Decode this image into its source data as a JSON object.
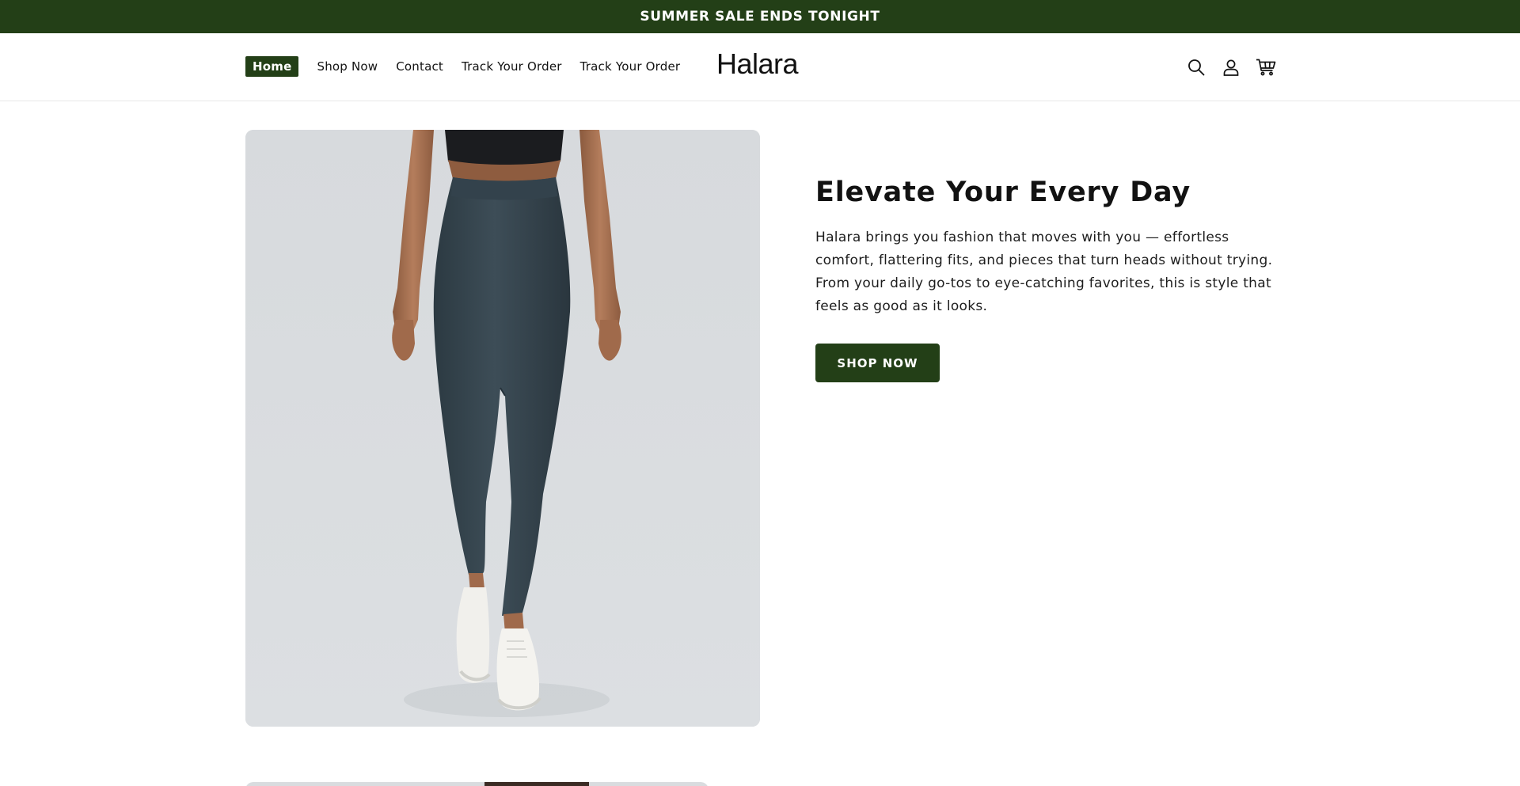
{
  "announcement": {
    "text": "SUMMER SALE ENDS TONIGHT"
  },
  "header": {
    "nav": [
      {
        "label": "Home",
        "active": true
      },
      {
        "label": "Shop Now",
        "active": false
      },
      {
        "label": "Contact",
        "active": false
      },
      {
        "label": "Track Your Order",
        "active": false
      },
      {
        "label": "Track Your Order",
        "active": false
      }
    ],
    "logo": "Halara",
    "icons": [
      "search-icon",
      "account-icon",
      "cart-icon"
    ]
  },
  "hero": {
    "image": "woman-in-dark-teal-leggings-and-white-sneakers",
    "heading": "Elevate Your Every Day",
    "body": "Halara brings you fashion that moves with you — effortless comfort, flattering fits, and pieces that turn heads without trying. From your daily go-tos to eye-catching favorites, this is style that feels as good as it looks.",
    "button_label": "SHOP NOW"
  },
  "colors": {
    "brand_green": "#233f17",
    "image_background": "#d9dcdf",
    "leggings": "#37464f"
  }
}
